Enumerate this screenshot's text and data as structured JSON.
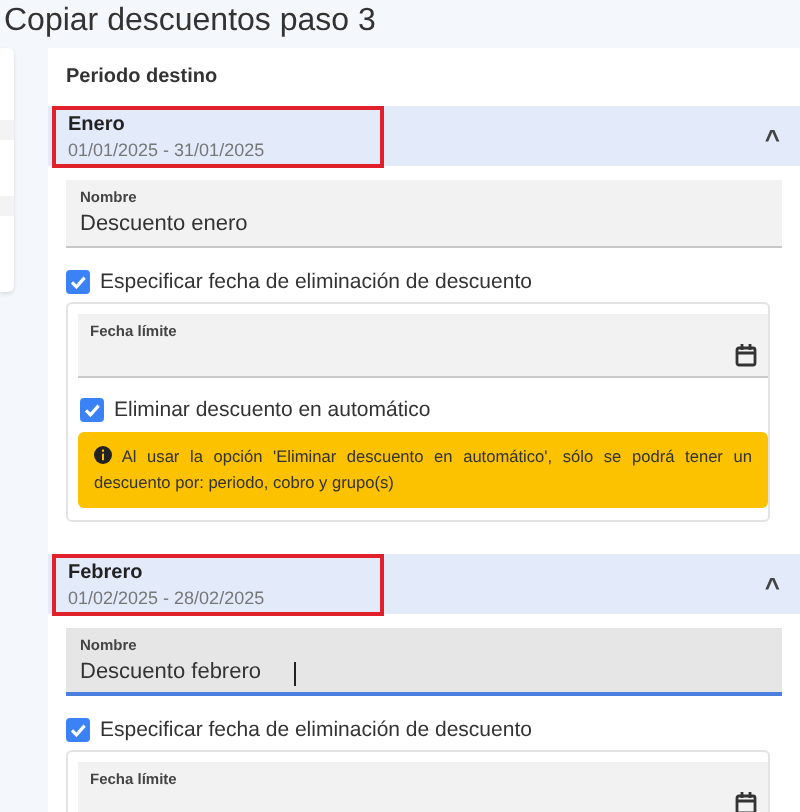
{
  "title": "Copiar descuentos paso 3",
  "section_title": "Periodo destino",
  "periods": [
    {
      "name": "Enero",
      "range": "01/01/2025 - 31/01/2025",
      "expanded": true,
      "highlighted": true,
      "chevron": "^",
      "name_field": {
        "label": "Nombre",
        "value": "Descuento enero",
        "focused": false
      },
      "specify_date": {
        "label": "Especificar fecha de eliminación de descuento",
        "checked": true
      },
      "date_field": {
        "label": "Fecha límite"
      },
      "auto_delete": {
        "label": "Eliminar descuento en automático",
        "checked": true
      },
      "warning": "Al usar la opción 'Eliminar descuento en automático', sólo se podrá tener un descuento por: periodo, cobro y grupo(s)"
    },
    {
      "name": "Febrero",
      "range": "01/02/2025 - 28/02/2025",
      "expanded": true,
      "highlighted": true,
      "chevron": "^",
      "name_field": {
        "label": "Nombre",
        "value": "Descuento febrero",
        "focused": true
      },
      "specify_date": {
        "label": "Especificar fecha de eliminación de descuento",
        "checked": true
      },
      "date_field": {
        "label": "Fecha límite"
      }
    }
  ]
}
